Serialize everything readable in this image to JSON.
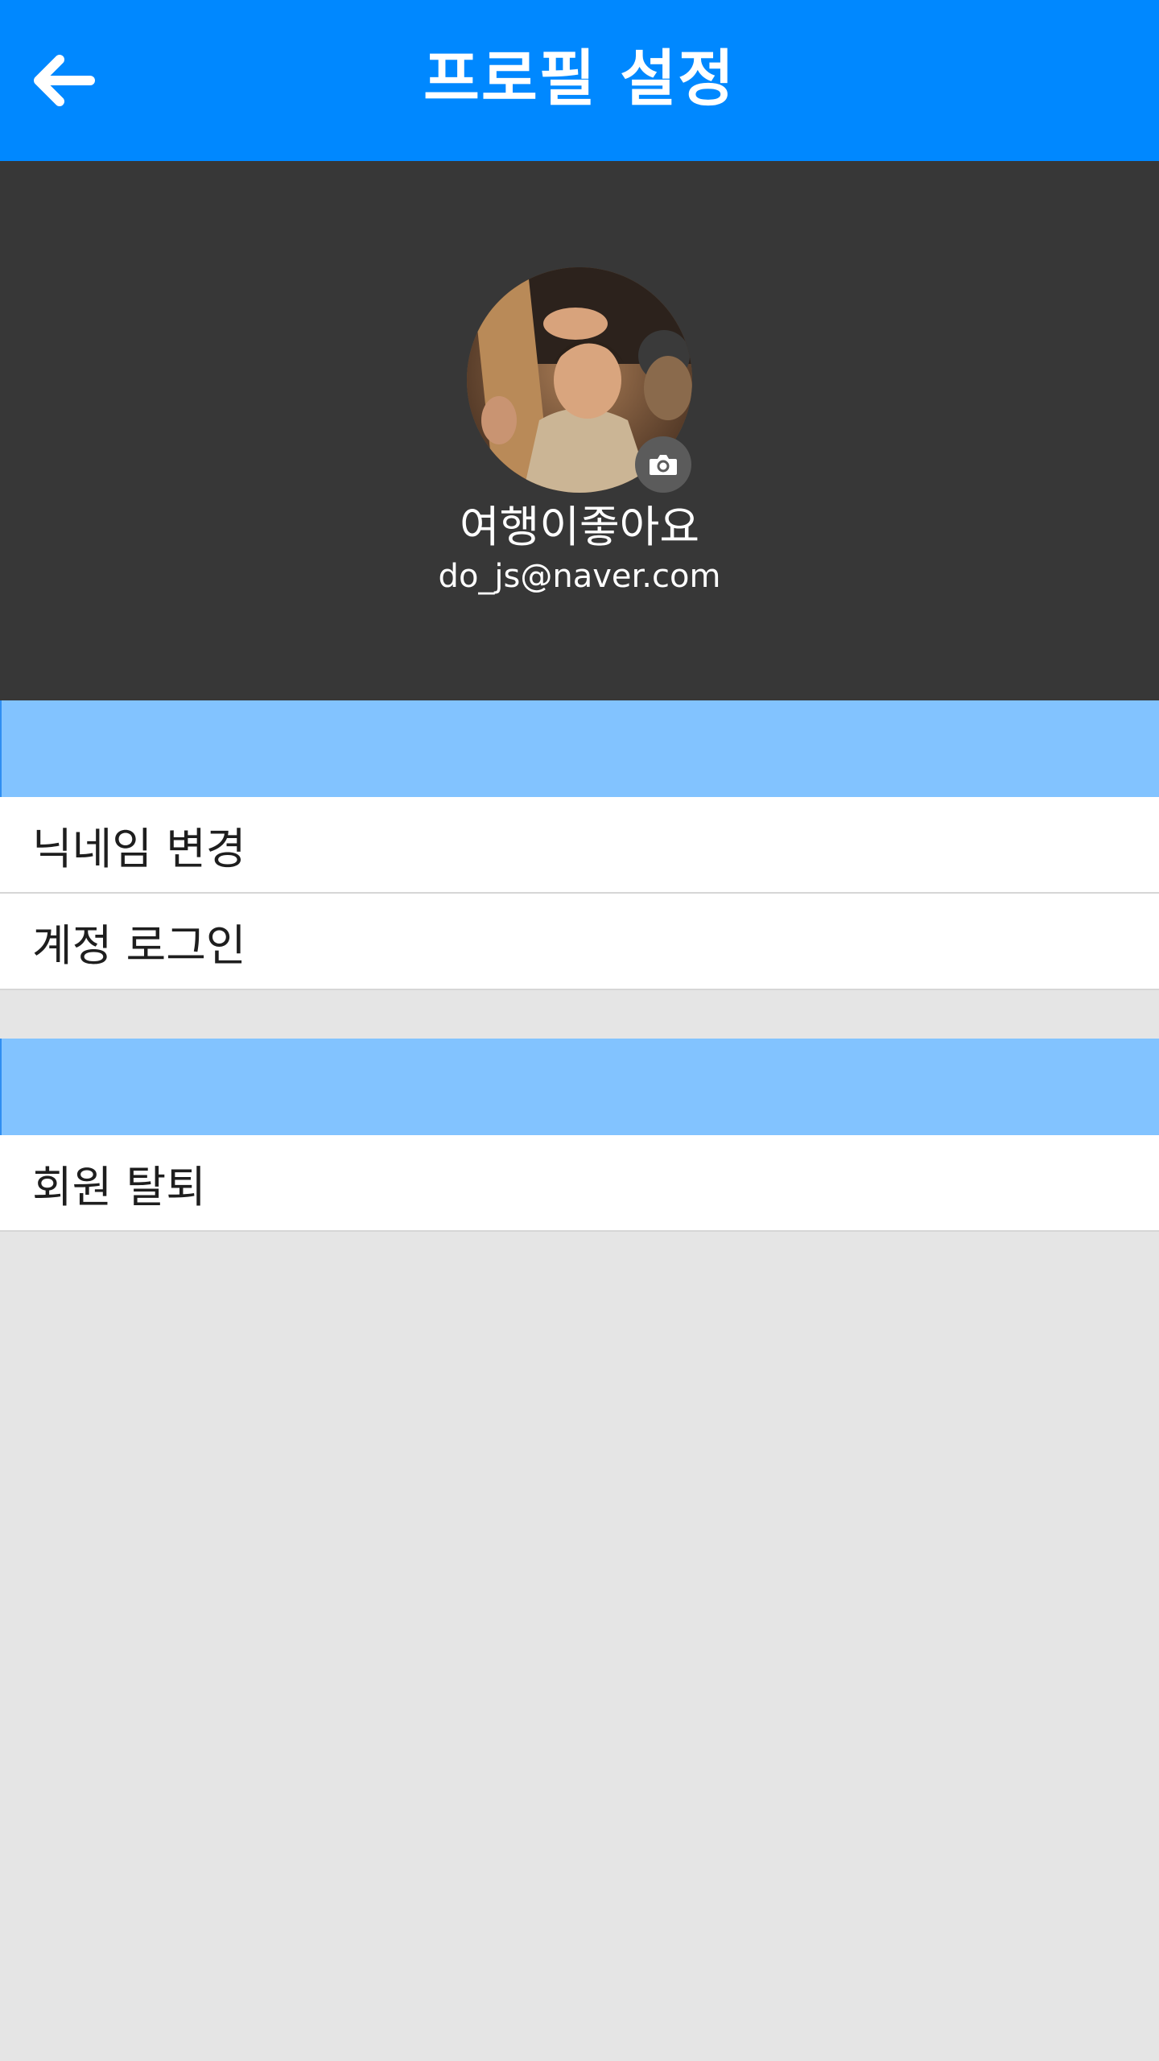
{
  "appbar": {
    "title": "프로필 설정",
    "back_icon": "arrow-left-icon",
    "color": "#0088ff"
  },
  "profile": {
    "avatar_icon": "avatar-photo",
    "camera_icon": "camera-icon",
    "name": "여행이좋아요",
    "email": "do_js@naver.com",
    "header_color": "#373737"
  },
  "sections": {
    "band_color": "#82c3ff",
    "account": {
      "items": [
        {
          "label": "닉네임 변경"
        },
        {
          "label": "계정 로그인"
        }
      ]
    },
    "membership": {
      "items": [
        {
          "label": "회원 탈퇴"
        }
      ]
    }
  }
}
